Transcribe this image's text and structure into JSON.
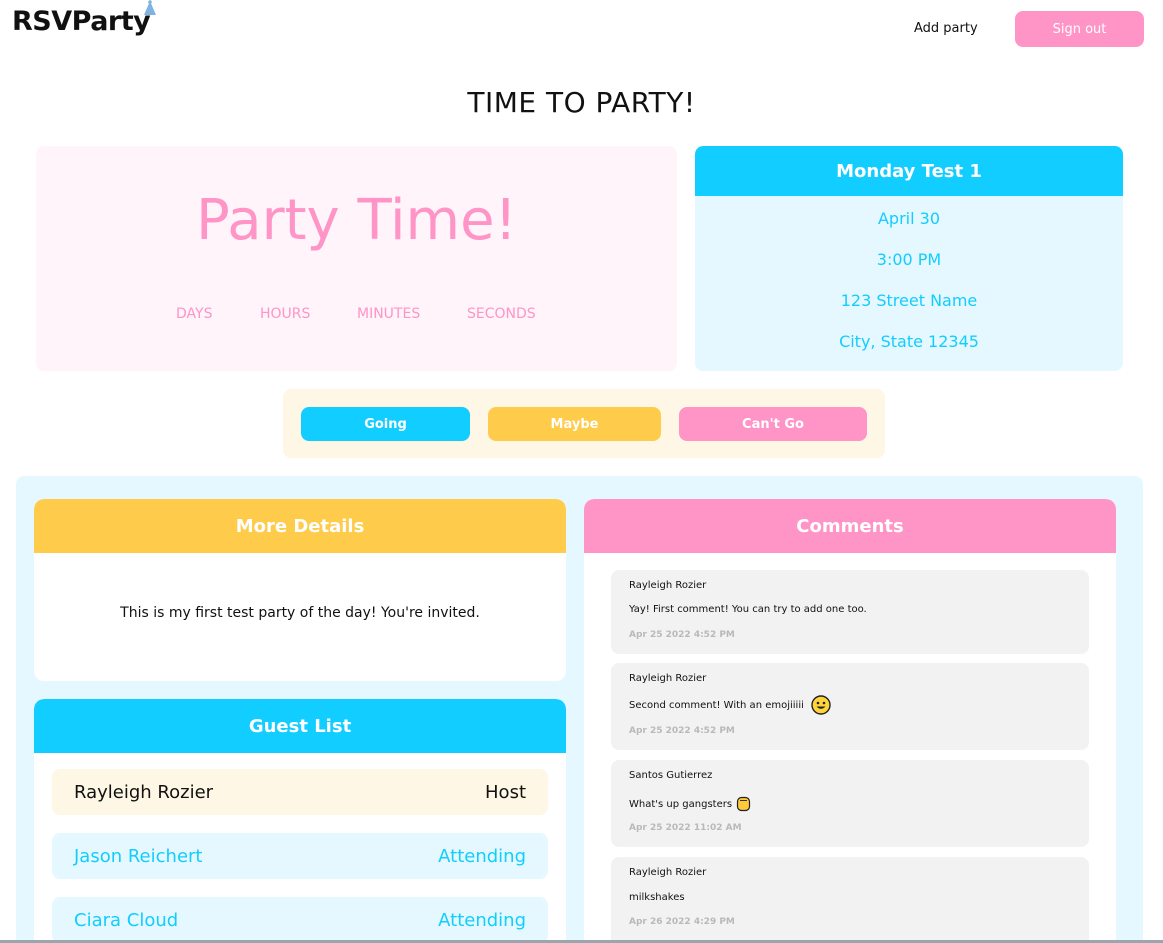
{
  "header": {
    "logo": "RSVParty",
    "add_party": "Add party",
    "sign_out": "Sign out"
  },
  "page_title": "TIME TO PARTY!",
  "countdown": {
    "headline": "Party Time!",
    "units": [
      "DAYS",
      "HOURS",
      "MINUTES",
      "SECONDS"
    ]
  },
  "party": {
    "name": "Monday Test 1",
    "date": "April 30",
    "time": "3:00 PM",
    "street": "123 Street Name",
    "city": "City, State 12345"
  },
  "rsvp": {
    "going": "Going",
    "maybe": "Maybe",
    "cant_go": "Can't Go"
  },
  "details": {
    "title": "More Details",
    "text": "This is my first test party of the day! You're invited."
  },
  "guests": {
    "title": "Guest List",
    "items": [
      {
        "name": "Rayleigh Rozier",
        "status": "Host"
      },
      {
        "name": "Jason Reichert",
        "status": "Attending"
      },
      {
        "name": "Ciara Cloud",
        "status": "Attending"
      }
    ]
  },
  "comments": {
    "title": "Comments",
    "items": [
      {
        "author": "Rayleigh Rozier",
        "text": "Yay! First comment! You can try to add one too.",
        "time": "Apr 25 2022 4:52 PM"
      },
      {
        "author": "Rayleigh Rozier",
        "text": "Second comment! With an emojiiiii",
        "time": "Apr 25 2022 4:52 PM",
        "emoji": "smiley-icon"
      },
      {
        "author": "Santos Gutierrez",
        "text": "What's up gangsters",
        "time": "Apr 25 2022 11:02 AM",
        "emoji": "fist-icon"
      },
      {
        "author": "Rayleigh Rozier",
        "text": "milkshakes",
        "time": "Apr 26 2022 4:29 PM"
      }
    ]
  },
  "colors": {
    "pink": "#ff94c6",
    "blue": "#12cdff",
    "yellow": "#fecb4b",
    "light_blue": "#e5f8ff",
    "light_pink": "#fff4f9",
    "light_yellow": "#fff7e5"
  }
}
